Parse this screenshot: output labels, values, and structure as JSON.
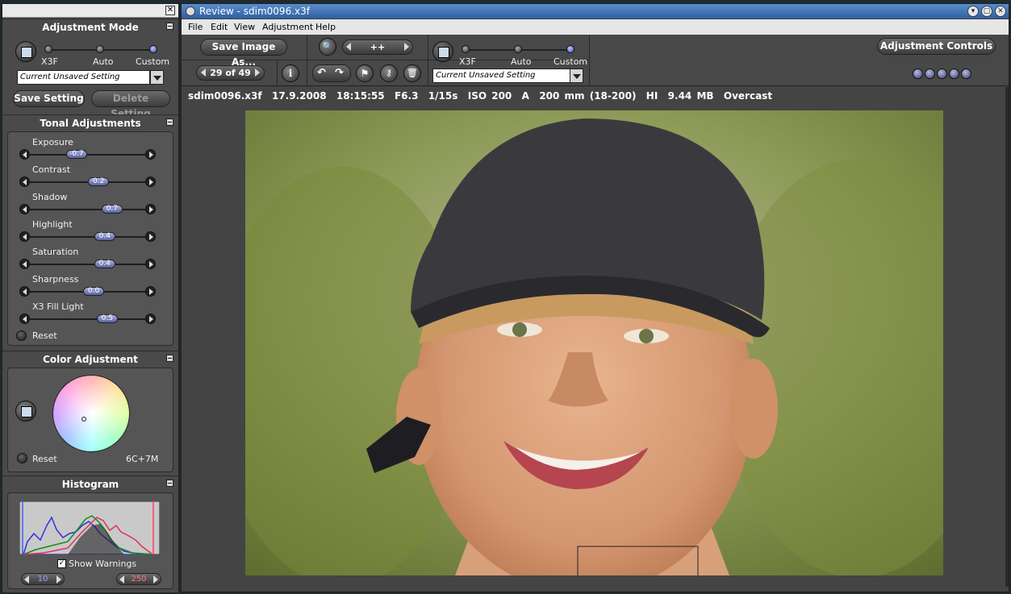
{
  "left_panel": {
    "adjustment_mode": {
      "title": "Adjustment Mode",
      "modes": [
        "X3F",
        "Auto",
        "Custom"
      ],
      "selected_mode": "Custom",
      "setting_value": "Current Unsaved Setting",
      "save_label": "Save Setting",
      "delete_label": "Delete Setting"
    },
    "tonal": {
      "title": "Tonal Adjustments",
      "sliders": [
        {
          "label": "Exposure",
          "value": "-0.7",
          "pos": 0.4
        },
        {
          "label": "Contrast",
          "value": "0.2",
          "pos": 0.58
        },
        {
          "label": "Shadow",
          "value": "0.7",
          "pos": 0.69
        },
        {
          "label": "Highlight",
          "value": "0.4",
          "pos": 0.63
        },
        {
          "label": "Saturation",
          "value": "0.4",
          "pos": 0.63
        },
        {
          "label": "Sharpness",
          "value": "0.0",
          "pos": 0.54
        },
        {
          "label": "X3 Fill Light",
          "value": "0.5",
          "pos": 0.65
        }
      ],
      "reset_label": "Reset"
    },
    "color": {
      "title": "Color Adjustment",
      "reset_label": "Reset",
      "readout": "6C+7M"
    },
    "histogram": {
      "title": "Histogram",
      "show_warnings_label": "Show Warnings",
      "show_warnings_checked": true,
      "low_value": "10",
      "high_value": "250"
    }
  },
  "window": {
    "title": "Review - sdim0096.x3f",
    "menu": [
      "File",
      "Edit",
      "View",
      "Adjustment",
      "Help"
    ],
    "toolbar": {
      "save_image_label": "Save Image As...",
      "zoom_label": "++",
      "counter": "29 of 49",
      "modes": [
        "X3F",
        "Auto",
        "Custom"
      ],
      "selected_mode": "Custom",
      "setting_value": "Current Unsaved Setting",
      "adjustment_controls_label": "Adjustment Controls"
    },
    "info": {
      "filename": "sdim0096.x3f",
      "date": "17.9.2008",
      "time": "18:15:55",
      "aperture": "F6.3",
      "shutter": "1/15s",
      "iso": "ISO 200",
      "mode": "A",
      "focal": "200 mm (18-200)",
      "quality": "HI",
      "size": "9.44 MB",
      "white_balance": "Overcast"
    }
  },
  "colors": {
    "panel_bg": "#4a4a4a",
    "titlebar": "#2f5f9f",
    "slider_thumb": "#7a82c0"
  }
}
